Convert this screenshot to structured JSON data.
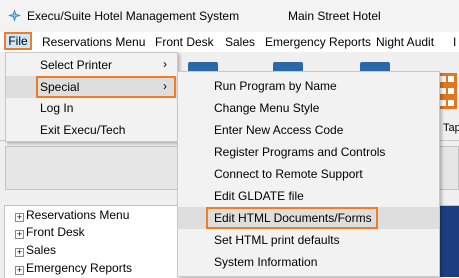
{
  "window": {
    "title": "Execu/Suite Hotel Management System",
    "hotel": "Main Street Hotel"
  },
  "menubar": {
    "items": [
      "File",
      "Reservations Menu",
      "Front Desk",
      "Sales",
      "Emergency Reports",
      "Night Audit",
      "I"
    ]
  },
  "file_menu": {
    "items": [
      {
        "label": "Select Printer",
        "arrow": "›"
      },
      {
        "label": "Special",
        "arrow": "›"
      },
      {
        "label": "Log In"
      },
      {
        "label": "Exit Execu/Tech"
      }
    ]
  },
  "special_menu": {
    "items": [
      "Run Program by Name",
      "Change Menu Style",
      "Enter New Access Code",
      "Register Programs and Controls",
      "Connect to Remote Support",
      "Edit GLDATE file",
      "Edit HTML Documents/Forms",
      "Set HTML print defaults",
      "System Information"
    ]
  },
  "toolbar": {
    "tap_label": "Tap"
  },
  "tree": {
    "items": [
      "Reservations Menu",
      "Front Desk",
      "Sales",
      "Emergency Reports"
    ],
    "expander": "+"
  },
  "colors": {
    "highlight_border": "#f07d26",
    "accent_blue": "#2b68a8"
  }
}
